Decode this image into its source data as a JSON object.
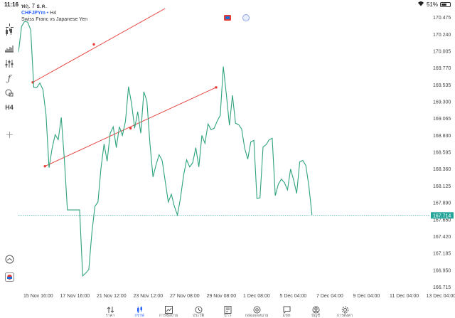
{
  "status_bar": {
    "time": "11:16",
    "date": "พฤ. 7 ธ.ค.",
    "battery": "51%",
    "battery_level": 0.51
  },
  "symbol": {
    "name": "CHFJPYm",
    "separator": "•",
    "timeframe": "H4",
    "description": "Swiss Franc vs Japanese Yen"
  },
  "toolbar": {
    "items": [
      "crosshair-icon",
      "candles-icon",
      "indicators-icon",
      "settings-sliders-icon",
      "function-icon",
      "shapes-icon"
    ],
    "timeframe_label": "H4"
  },
  "chart_data": {
    "type": "line",
    "title": "",
    "series": [
      {
        "color": "#2ea37a",
        "values": [
          169.99,
          170.35,
          170.42,
          170.41,
          170.3,
          169.5,
          169.5,
          169.56,
          169.47,
          169.12,
          168.38,
          168.65,
          168.84,
          168.77,
          169.08,
          168.5,
          167.79,
          167.79,
          167.79,
          167.79,
          167.79,
          166.87,
          166.91,
          166.96,
          167.47,
          167.84,
          167.9,
          168.38,
          168.71,
          168.47,
          168.86,
          168.95,
          168.66,
          168.95,
          168.83,
          169.03,
          169.51,
          169.27,
          168.93,
          169.16,
          168.86,
          169.44,
          169.31,
          168.72,
          168.25,
          168.42,
          168.56,
          168.48,
          168.19,
          167.9,
          168.01,
          167.84,
          167.72,
          167.96,
          168.27,
          168.49,
          168.39,
          168.45,
          168.66,
          168.39,
          168.83,
          168.72,
          168.99,
          168.91,
          168.93,
          169.03,
          169.11,
          169.79,
          169.4,
          168.97,
          169.39,
          169.0,
          168.98,
          168.92,
          168.65,
          168.5,
          168.74,
          168.76,
          167.95,
          167.96,
          168.67,
          168.7,
          168.77,
          168.79,
          167.99,
          168.15,
          168.22,
          168.17,
          168.07,
          168.36,
          168.21,
          168.02,
          168.46,
          168.48,
          168.41,
          168.12,
          167.72
        ]
      }
    ],
    "x_tick_labels": [
      "15 Nov 16:00",
      "17 Nov 16:00",
      "21 Nov 12:00",
      "23 Nov 12:00",
      "27 Nov 08:00",
      "29 Nov 08:00",
      "1 Dec 08:00",
      "5 Dec 04:00",
      "7 Dec 04:00",
      "9 Dec 04:00",
      "11 Dec 04:00",
      "13 Dec 04:00"
    ],
    "y_tick_labels": [
      "170.475",
      "170.240",
      "170.005",
      "169.770",
      "169.535",
      "169.300",
      "169.065",
      "168.830",
      "168.595",
      "168.360",
      "168.125",
      "167.890",
      "167.650",
      "167.420",
      "167.185",
      "166.950",
      "166.715"
    ],
    "ylim": [
      166.63,
      170.6
    ],
    "current_price": "167.714",
    "current_price_value": 167.714,
    "trendlines": [
      {
        "color": "#e53935",
        "points": [
          [
            0,
            169.57
          ],
          [
            20,
            170.1
          ],
          [
            50,
            170.76
          ]
        ]
      },
      {
        "color": "#e53935",
        "points": [
          [
            4,
            168.4
          ],
          [
            32,
            168.93
          ],
          [
            60,
            169.5
          ]
        ]
      }
    ]
  },
  "nav": {
    "active_index": 1,
    "items": [
      {
        "icon": "quotes-arrows-icon",
        "label": "ราคา"
      },
      {
        "icon": "chart-icon",
        "label": "กราฟ"
      },
      {
        "icon": "trade-icon",
        "label": "การซื้อขาย"
      },
      {
        "icon": "history-icon",
        "label": "ประวัติ"
      },
      {
        "icon": "news-icon",
        "label": "ข่าว"
      },
      {
        "icon": "mailbox-icon",
        "label": "กล่องจดหมาย"
      },
      {
        "icon": "chat-icon",
        "label": "แชท"
      },
      {
        "icon": "account-icon",
        "label": "บัญชี"
      },
      {
        "icon": "settings-gear-icon",
        "label": "การตั้งค่า"
      }
    ]
  }
}
